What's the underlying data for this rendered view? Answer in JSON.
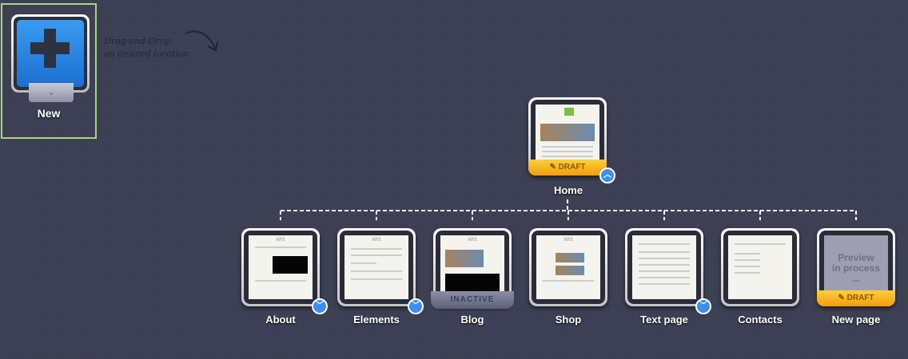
{
  "new_item": {
    "label": "New",
    "hint_line1": "Drag-and-Drop",
    "hint_line2": "on desired location"
  },
  "root": {
    "label": "Home",
    "status": "DRAFT",
    "toggle": "collapse"
  },
  "children": [
    {
      "label": "About",
      "status": "",
      "toggle": true
    },
    {
      "label": "Elements",
      "status": "",
      "toggle": true
    },
    {
      "label": "Blog",
      "status": "INACTIVE",
      "toggle": false
    },
    {
      "label": "Shop",
      "status": "",
      "toggle": false
    },
    {
      "label": "Text page",
      "status": "",
      "toggle": true
    },
    {
      "label": "Contacts",
      "status": "",
      "toggle": false
    },
    {
      "label": "New page",
      "status": "DRAFT",
      "toggle": false,
      "preview_line1": "Preview",
      "preview_line2": "in process",
      "preview_line3": "..."
    }
  ],
  "colors": {
    "accent": "#3a8ff0",
    "draft": "#f5b21c",
    "highlight": "#a9d484"
  }
}
